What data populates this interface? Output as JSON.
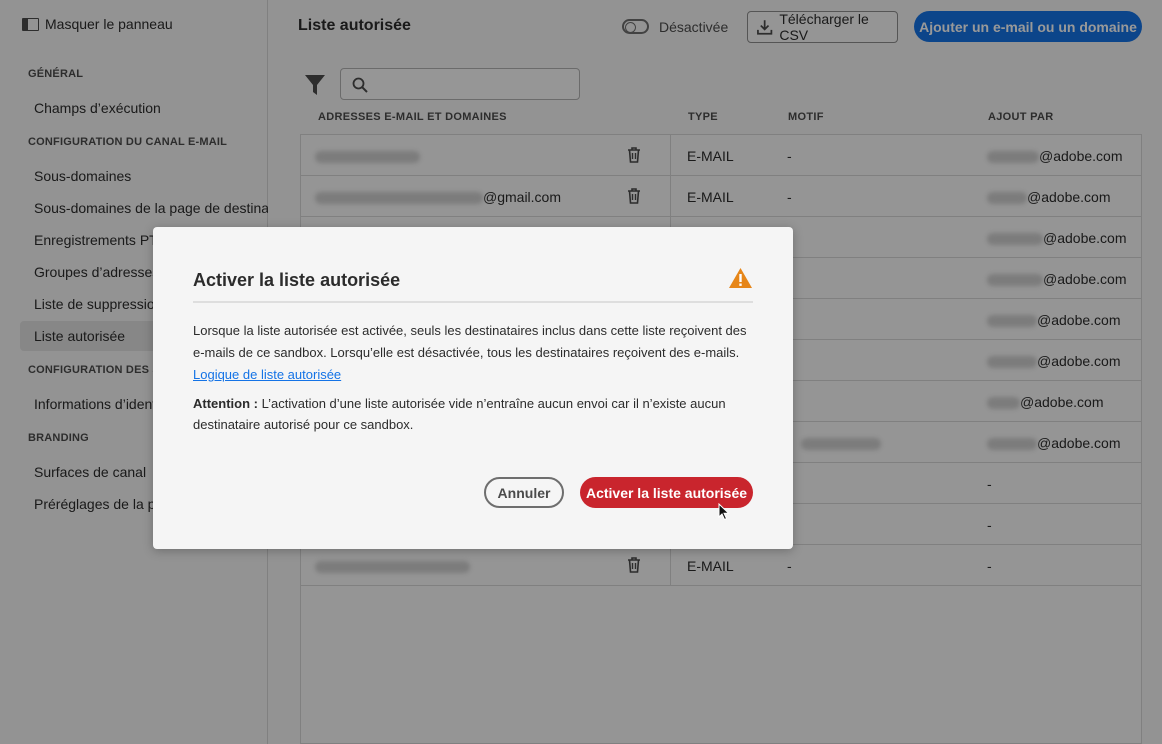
{
  "sidebar": {
    "toggle_label": "Masquer le panneau",
    "sections": [
      {
        "title": "GÉNÉRAL"
      },
      {
        "title": "CONFIGURATION DU CANAL E-MAIL"
      },
      {
        "title": "CONFIGURATION DES SMS"
      },
      {
        "title": "BRANDING"
      }
    ],
    "items": [
      {
        "label": "Champs d’exécution"
      },
      {
        "label": "Sous-domaines"
      },
      {
        "label": "Sous-domaines de la page de destination"
      },
      {
        "label": "Enregistrements PTR"
      },
      {
        "label": "Groupes d’adresses IP"
      },
      {
        "label": "Liste de suppression"
      },
      {
        "label": "Liste autorisée"
      },
      {
        "label": "Informations d’identification"
      },
      {
        "label": "Surfaces de canal"
      },
      {
        "label": "Préréglages de la page"
      }
    ]
  },
  "header": {
    "title": "Liste autorisée",
    "toggle_label": "Désactivée",
    "download_label": "Télécharger le CSV",
    "add_label": "Ajouter un e-mail ou un domaine"
  },
  "table": {
    "columns": [
      "ADRESSES E-MAIL ET DOMAINES",
      "TYPE",
      "MOTIF",
      "AJOUT PAR"
    ],
    "rows": [
      {
        "address_suffix": "",
        "type": "E-MAIL",
        "reason": "-",
        "added_by": "@adobe.com"
      },
      {
        "address_suffix": "@gmail.com",
        "type": "E-MAIL",
        "reason": "-",
        "added_by": "@adobe.com"
      },
      {
        "added_by": "@adobe.com"
      },
      {
        "added_by": "@adobe.com"
      },
      {
        "added_by": "@adobe.com"
      },
      {
        "added_by": "@adobe.com"
      },
      {
        "added_by": "@adobe.com"
      },
      {
        "added_by": "@adobe.com"
      },
      {
        "added_by": "-"
      },
      {
        "added_by": "-"
      },
      {
        "type": "E-MAIL",
        "reason": "-",
        "added_by": "-"
      }
    ]
  },
  "modal": {
    "title": "Activer la liste autorisée",
    "body": "Lorsque la liste autorisée est activée, seuls les destinataires inclus dans cette liste reçoivent des e-mails de ce sandbox. Lorsqu’elle est désactivée, tous les destinataires reçoivent des e-mails.",
    "link": "Logique de liste autorisée",
    "attention_label": "Attention :",
    "attention_text": "L’activation d’une liste autorisée vide n’entraîne aucun envoi car il n’existe aucun destinataire autorisé pour ce sandbox.",
    "cancel_label": "Annuler",
    "confirm_label": "Activer la liste autorisée"
  },
  "colors": {
    "primary": "#1473e6",
    "danger": "#c9252d",
    "warning": "#e68619"
  }
}
